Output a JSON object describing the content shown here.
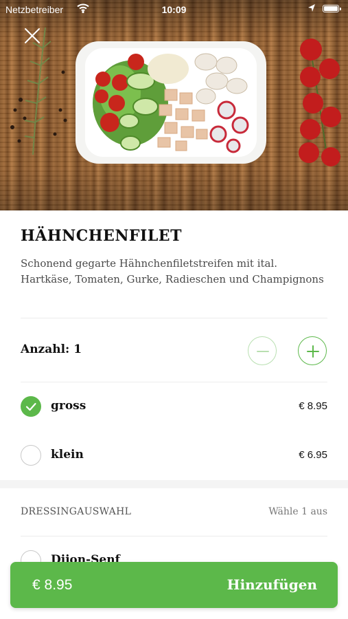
{
  "status_bar": {
    "carrier": "Netzbetreiber",
    "time": "10:09"
  },
  "product": {
    "title": "HÄHNCHENFILET",
    "description": "Schonend gegarte Hähnchenfiletstreifen mit ital. Hartkäse, Tomaten, Gurke, Radieschen und Champignons"
  },
  "quantity": {
    "label": "Anzahl: 1",
    "value": 1
  },
  "sizes": [
    {
      "label": "gross",
      "price": "€ 8.95",
      "selected": true
    },
    {
      "label": "klein",
      "price": "€ 6.95",
      "selected": false
    }
  ],
  "dressing": {
    "title": "DRESSINGAUSWAHL",
    "hint": "Wähle 1 aus",
    "options": [
      {
        "label": "Dijon-Senf",
        "selected": false
      }
    ]
  },
  "cta": {
    "price": "€ 8.95",
    "label": "Hinzufügen"
  },
  "colors": {
    "accent": "#5cb84a",
    "accent_light": "#b8dfb0",
    "text": "#111111",
    "muted": "#4a4a4a"
  },
  "icons": {
    "close": "close-icon",
    "minus": "minus-icon",
    "plus": "plus-icon",
    "check": "check-icon",
    "wifi": "wifi-icon",
    "location": "location-arrow-icon",
    "battery": "battery-icon"
  }
}
